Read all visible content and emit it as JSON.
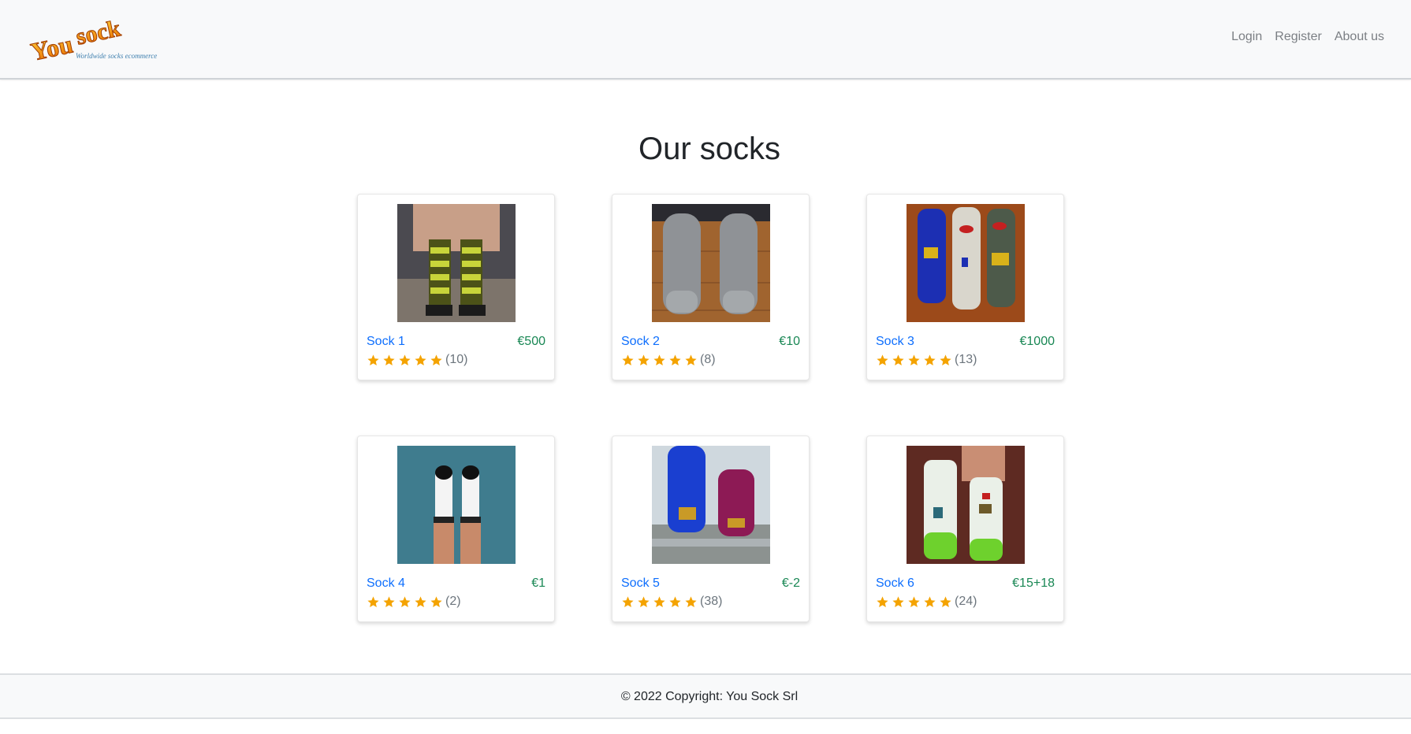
{
  "brand": {
    "logo_main": "You Sock",
    "logo_tagline": "Worldwide socks ecommerce"
  },
  "nav": {
    "login": "Login",
    "register": "Register",
    "about": "About us"
  },
  "main": {
    "title": "Our socks"
  },
  "products": [
    {
      "name": "Sock 1",
      "price": "€500",
      "rating": 5,
      "reviews": "(10)"
    },
    {
      "name": "Sock 2",
      "price": "€10",
      "rating": 5,
      "reviews": "(8)"
    },
    {
      "name": "Sock 3",
      "price": "€1000",
      "rating": 5,
      "reviews": "(13)"
    },
    {
      "name": "Sock 4",
      "price": "€1",
      "rating": 5,
      "reviews": "(2)"
    },
    {
      "name": "Sock 5",
      "price": "€-2",
      "rating": 5,
      "reviews": "(38)"
    },
    {
      "name": "Sock 6",
      "price": "€15+18",
      "rating": 5,
      "reviews": "(24)"
    }
  ],
  "colors": {
    "link": "#0d6efd",
    "price": "#198754",
    "star": "#f4a300",
    "muted": "#6c757d"
  },
  "icons": {
    "star": "star-icon"
  },
  "footer": {
    "text": "© 2022 Copyright: You Sock Srl"
  }
}
